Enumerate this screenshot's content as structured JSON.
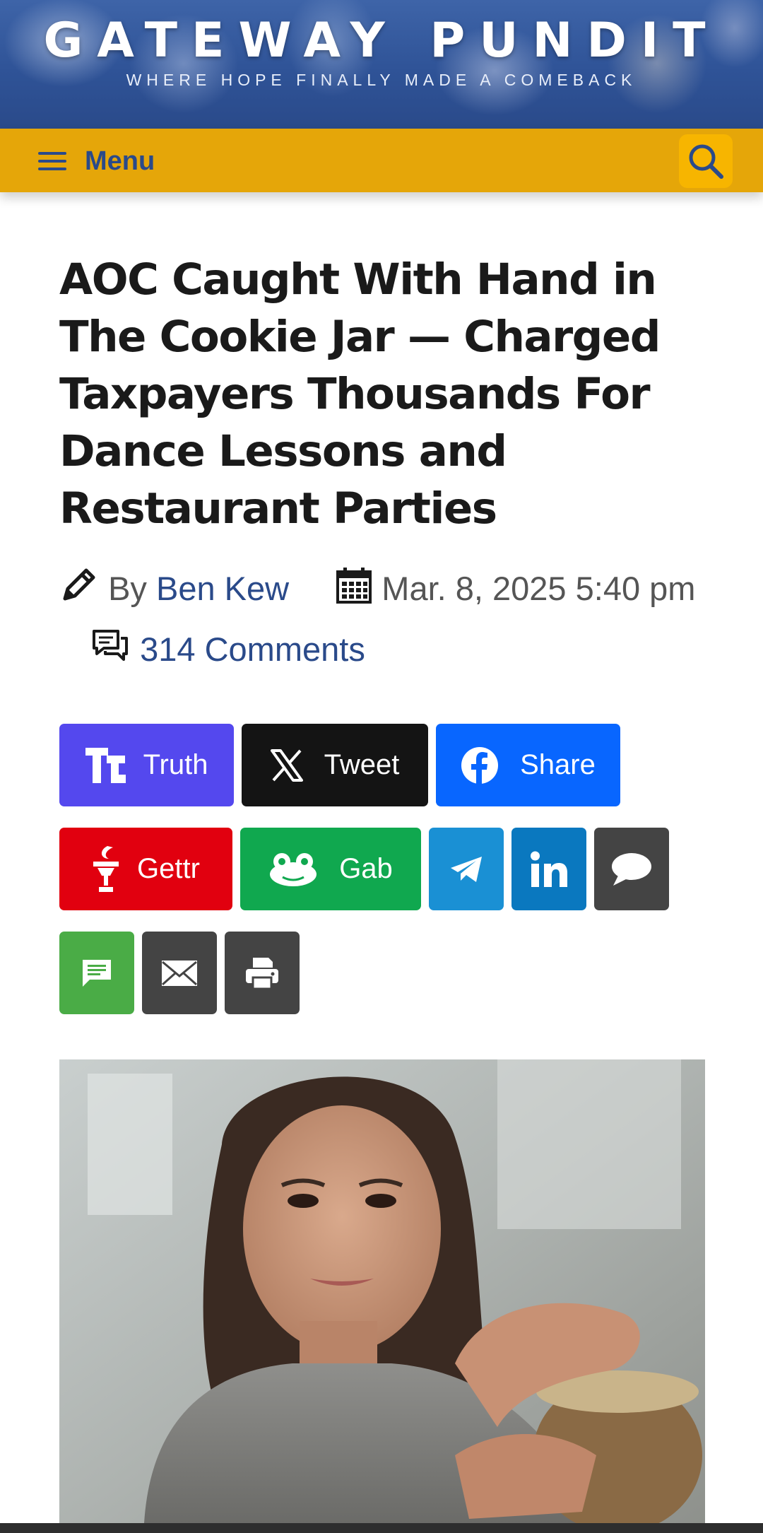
{
  "site": {
    "title": "GATEWAY PUNDIT",
    "tagline": "WHERE HOPE FINALLY MADE A COMEBACK"
  },
  "nav": {
    "menu_label": "Menu",
    "search_icon": "search-icon",
    "menu_icon": "hamburger-icon"
  },
  "article": {
    "headline": "AOC Caught With Hand in The Cookie Jar — Charged Taxpayers Thousands For Dance Lessons and Restaurant Parties",
    "by_label": "By",
    "author": "Ben Kew",
    "date": "Mar. 8, 2025 5:40 pm",
    "comments": "314 Comments"
  },
  "share": [
    {
      "id": "truth",
      "label": "Truth",
      "icon": "truth-social-icon",
      "color": "#5448ee"
    },
    {
      "id": "tweet",
      "label": "Tweet",
      "icon": "x-icon",
      "color": "#141414"
    },
    {
      "id": "share",
      "label": "Share",
      "icon": "facebook-icon",
      "color": "#0866ff"
    },
    {
      "id": "gettr",
      "label": "Gettr",
      "icon": "gettr-icon",
      "color": "#e1000f"
    },
    {
      "id": "gab",
      "label": "Gab",
      "icon": "gab-frog-icon",
      "color": "#10a84f"
    },
    {
      "id": "telegram",
      "label": "",
      "icon": "telegram-icon",
      "color": "#1a90d4"
    },
    {
      "id": "linkedin",
      "label": "",
      "icon": "linkedin-icon",
      "color": "#0a78bf"
    },
    {
      "id": "comment",
      "label": "",
      "icon": "speech-bubble-icon",
      "color": "#444444"
    },
    {
      "id": "sms",
      "label": "",
      "icon": "sms-icon",
      "color": "#4aac46"
    },
    {
      "id": "email",
      "label": "",
      "icon": "email-icon",
      "color": "#444444"
    },
    {
      "id": "print",
      "label": "",
      "icon": "printer-icon",
      "color": "#444444"
    }
  ],
  "colors": {
    "banner_blue": "#2f5397",
    "menu_gold": "#e5a609",
    "search_gold": "#f7b500",
    "link_blue": "#2a4a8a"
  }
}
